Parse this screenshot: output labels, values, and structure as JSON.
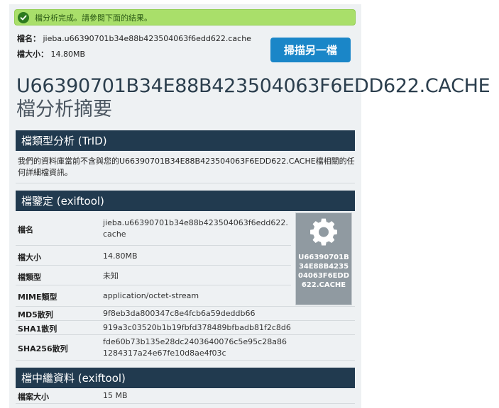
{
  "alert": {
    "message": "檔分析完成。請參閱下面的結果。"
  },
  "file": {
    "name_label": "檔名：",
    "name_value": "jieba.u66390701b34e88b423504063f6edd622.cache",
    "size_label": "檔大小：",
    "size_value": "14.80MB"
  },
  "actions": {
    "rescan_label": "掃描另一檔"
  },
  "headline": {
    "title": "U66390701B34E88B423504063F6EDD622.CACHE",
    "subtitle": "檔分析摘要"
  },
  "trid": {
    "heading": "檔類型分析 (TrID)",
    "text": "我們的資料庫當前不含與您的U66390701B34E88B423504063F6EDD622.CACHE檔相關的任何詳細檔資訊。"
  },
  "exif": {
    "heading": "檔鑒定 (exiftool)",
    "rows": [
      {
        "label": "檔名",
        "value": "jieba.u66390701b34e88b423504063f6edd622.cache"
      },
      {
        "label": "檔大小",
        "value": "14.80MB"
      },
      {
        "label": "檔類型",
        "value": "未知"
      },
      {
        "label": "MIME類型",
        "value": "application/octet-stream"
      },
      {
        "label": "MD5散列",
        "value": "9f8eb3da800347c8e4fcb6a59deddb66"
      },
      {
        "label": "SHA1散列",
        "value": "919a3c03520b1b19fbfd378489bfbadb81f2c8d6"
      },
      {
        "label": "SHA256散列",
        "value": "fde60b73b135e28dc2403640076c5e95c28a861284317a24e67fe10d8ae4f03c"
      }
    ],
    "card_name": "U66390701B34E88B423504063F6EDD622.CACHE",
    "card_icon": "gear-icon"
  },
  "embedded": {
    "heading": "檔中繼資料 (exiftool)",
    "rows": [
      {
        "label": "檔案大小",
        "value": "15 MB"
      }
    ]
  },
  "colors": {
    "section_header": "#213a4f",
    "alert_bg": "#a9df6a",
    "button_bg": "#1a86c8",
    "card_bg": "#909aa1"
  }
}
